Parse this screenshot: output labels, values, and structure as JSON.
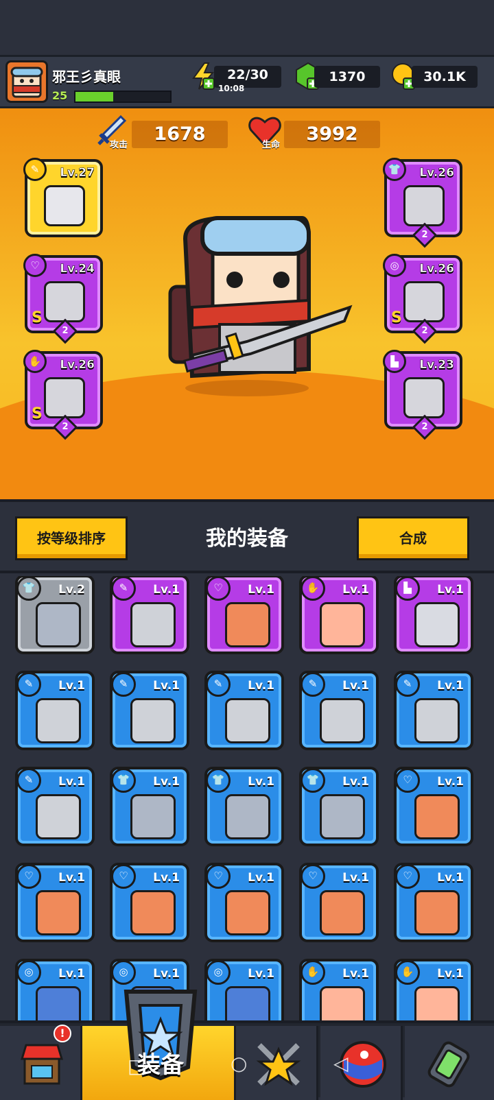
{
  "player": {
    "name": "邪王彡真眼",
    "level": "25",
    "xp_fraction": 0.4
  },
  "resources": {
    "energy": {
      "value": "22/30",
      "timer": "10:08"
    },
    "gems": {
      "value": "1370"
    },
    "coins": {
      "value": "30.1K"
    }
  },
  "stats": {
    "attack": {
      "label": "攻击",
      "value": "1678"
    },
    "health": {
      "label": "生命",
      "value": "3992"
    }
  },
  "equipped": [
    {
      "slot": "weapon",
      "level": "Lv.27",
      "color": "yellow",
      "rank": "",
      "s": ""
    },
    {
      "slot": "necklace",
      "level": "Lv.24",
      "color": "purple",
      "rank": "2",
      "s": "S"
    },
    {
      "slot": "glove",
      "level": "Lv.26",
      "color": "purple",
      "rank": "2",
      "s": "S"
    },
    {
      "slot": "armor",
      "level": "Lv.26",
      "color": "purple",
      "rank": "2",
      "s": ""
    },
    {
      "slot": "belt",
      "level": "Lv.26",
      "color": "purple",
      "rank": "2",
      "s": "S"
    },
    {
      "slot": "boots",
      "level": "Lv.23",
      "color": "purple",
      "rank": "2",
      "s": ""
    }
  ],
  "inventory": {
    "sort_label": "按等级排序",
    "title": "我的装备",
    "merge_label": "合成",
    "items": [
      {
        "level": "Lv.2",
        "color": "gray",
        "icon": "armor-icon"
      },
      {
        "level": "Lv.1",
        "color": "purple",
        "icon": "weapon-icon"
      },
      {
        "level": "Lv.1",
        "color": "purple",
        "icon": "necklace-icon"
      },
      {
        "level": "Lv.1",
        "color": "purple",
        "icon": "glove-icon"
      },
      {
        "level": "Lv.1",
        "color": "purple",
        "icon": "boots-icon"
      },
      {
        "level": "Lv.1",
        "color": "blue",
        "icon": "weapon-icon"
      },
      {
        "level": "Lv.1",
        "color": "blue",
        "icon": "weapon-icon"
      },
      {
        "level": "Lv.1",
        "color": "blue",
        "icon": "weapon-icon"
      },
      {
        "level": "Lv.1",
        "color": "blue",
        "icon": "weapon-icon"
      },
      {
        "level": "Lv.1",
        "color": "blue",
        "icon": "weapon-icon"
      },
      {
        "level": "Lv.1",
        "color": "blue",
        "icon": "weapon-icon"
      },
      {
        "level": "Lv.1",
        "color": "blue",
        "icon": "armor-icon"
      },
      {
        "level": "Lv.1",
        "color": "blue",
        "icon": "armor-icon"
      },
      {
        "level": "Lv.1",
        "color": "blue",
        "icon": "armor-icon"
      },
      {
        "level": "Lv.1",
        "color": "blue",
        "icon": "necklace-icon"
      },
      {
        "level": "Lv.1",
        "color": "blue",
        "icon": "necklace-icon"
      },
      {
        "level": "Lv.1",
        "color": "blue",
        "icon": "necklace-icon"
      },
      {
        "level": "Lv.1",
        "color": "blue",
        "icon": "necklace-icon"
      },
      {
        "level": "Lv.1",
        "color": "blue",
        "icon": "necklace-icon"
      },
      {
        "level": "Lv.1",
        "color": "blue",
        "icon": "necklace-icon"
      },
      {
        "level": "Lv.1",
        "color": "blue",
        "icon": "belt-icon"
      },
      {
        "level": "Lv.1",
        "color": "blue",
        "icon": "belt-icon"
      },
      {
        "level": "Lv.1",
        "color": "blue",
        "icon": "belt-icon"
      },
      {
        "level": "Lv.1",
        "color": "blue",
        "icon": "glove-icon"
      },
      {
        "level": "Lv.1",
        "color": "blue",
        "icon": "glove-icon"
      }
    ]
  },
  "nav": {
    "active_label": "装备"
  },
  "colors": {
    "blue": "#2b8de8",
    "purple": "#b53ce6",
    "gray": "#9aa0a8",
    "yellow": "#ffd52c",
    "orange": "#f08f10"
  }
}
